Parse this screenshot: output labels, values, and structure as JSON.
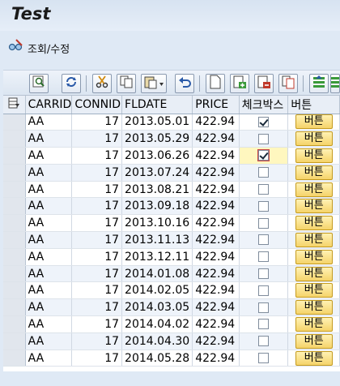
{
  "window": {
    "title": "Test"
  },
  "app_toolbar": {
    "edit_label": "조회/수정",
    "edit_icon": "glasses-pencil-icon"
  },
  "grid_toolbar": {
    "buttons": [
      "details-icon",
      "refresh-icon",
      "cut-icon",
      "copy-icon",
      "paste-icon",
      "undo-icon",
      "append-row-icon",
      "insert-row-icon",
      "delete-row-icon",
      "copy-row-icon",
      "sort-ascending-icon",
      "sort-descending-icon"
    ]
  },
  "table": {
    "columns": [
      "CARRID",
      "CONNID",
      "FLDATE",
      "PRICE",
      "체크박스",
      "버튼"
    ],
    "button_label": "버튼",
    "rows": [
      {
        "carrid": "AA",
        "connid": "17",
        "fldate": "2013.05.01",
        "price": "422.94",
        "checked": true
      },
      {
        "carrid": "AA",
        "connid": "17",
        "fldate": "2013.05.29",
        "price": "422.94",
        "checked": false
      },
      {
        "carrid": "AA",
        "connid": "17",
        "fldate": "2013.06.26",
        "price": "422.94",
        "checked": true,
        "focused": true
      },
      {
        "carrid": "AA",
        "connid": "17",
        "fldate": "2013.07.24",
        "price": "422.94",
        "checked": false
      },
      {
        "carrid": "AA",
        "connid": "17",
        "fldate": "2013.08.21",
        "price": "422.94",
        "checked": false
      },
      {
        "carrid": "AA",
        "connid": "17",
        "fldate": "2013.09.18",
        "price": "422.94",
        "checked": false
      },
      {
        "carrid": "AA",
        "connid": "17",
        "fldate": "2013.10.16",
        "price": "422.94",
        "checked": false
      },
      {
        "carrid": "AA",
        "connid": "17",
        "fldate": "2013.11.13",
        "price": "422.94",
        "checked": false
      },
      {
        "carrid": "AA",
        "connid": "17",
        "fldate": "2013.12.11",
        "price": "422.94",
        "checked": false
      },
      {
        "carrid": "AA",
        "connid": "17",
        "fldate": "2014.01.08",
        "price": "422.94",
        "checked": false
      },
      {
        "carrid": "AA",
        "connid": "17",
        "fldate": "2014.02.05",
        "price": "422.94",
        "checked": false
      },
      {
        "carrid": "AA",
        "connid": "17",
        "fldate": "2014.03.05",
        "price": "422.94",
        "checked": false
      },
      {
        "carrid": "AA",
        "connid": "17",
        "fldate": "2014.04.02",
        "price": "422.94",
        "checked": false
      },
      {
        "carrid": "AA",
        "connid": "17",
        "fldate": "2014.04.30",
        "price": "422.94",
        "checked": false
      },
      {
        "carrid": "AA",
        "connid": "17",
        "fldate": "2014.05.28",
        "price": "422.94",
        "checked": false
      }
    ]
  },
  "colors": {
    "accent": "#f5d36a",
    "background": "#dfe9f5",
    "row_alt": "#eef3fa",
    "focus_cell": "#fff7bf"
  }
}
